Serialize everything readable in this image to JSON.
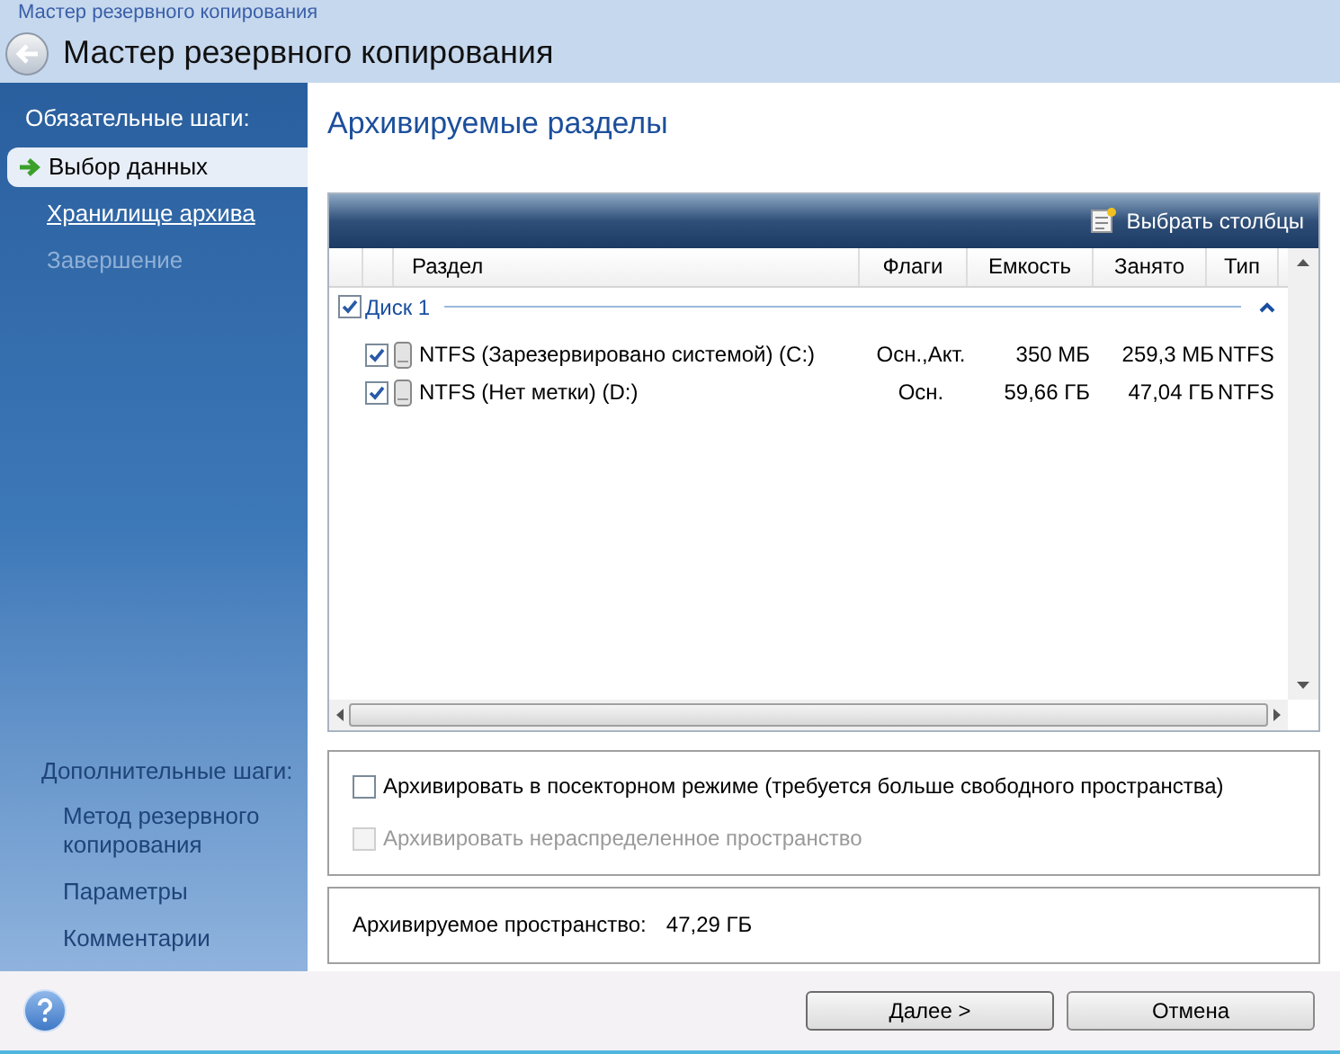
{
  "window": {
    "caption": "Мастер резервного копирования",
    "title": "Мастер резервного копирования"
  },
  "sidebar": {
    "required_heading": "Обязательные шаги:",
    "required_steps": [
      {
        "label": "Выбор данных",
        "kind": "current",
        "selected": true
      },
      {
        "label": "Хранилище архива",
        "kind": "link",
        "selected": false
      },
      {
        "label": "Завершение",
        "kind": "disabled",
        "selected": false
      }
    ],
    "optional_heading": "Дополнительные шаги:",
    "optional_steps": [
      {
        "label": "Метод резервного копирования"
      },
      {
        "label": "Параметры"
      },
      {
        "label": "Комментарии"
      }
    ]
  },
  "content": {
    "title": "Архивируемые разделы",
    "toolbar_button": "Выбрать столбцы",
    "table": {
      "columns": [
        "Раздел",
        "Флаги",
        "Емкость",
        "Занято",
        "Тип"
      ],
      "group": {
        "label": "Диск 1",
        "checked": true,
        "expanded": true
      },
      "rows": [
        {
          "checked": true,
          "name": "NTFS (Зарезервировано системой) (C:)",
          "flags": "Осн.,Акт.",
          "capacity": "350 МБ",
          "used": "259,3 МБ",
          "type": "NTFS"
        },
        {
          "checked": true,
          "name": "NTFS (Нет метки) (D:)",
          "flags": "Осн.",
          "capacity": "59,66 ГБ",
          "used": "47,04 ГБ",
          "type": "NTFS"
        }
      ]
    },
    "options": [
      {
        "label": "Архивировать в посекторном режиме (требуется больше свободного пространства)",
        "checked": false,
        "disabled": false
      },
      {
        "label": "Архивировать нераспределенное пространство",
        "checked": false,
        "disabled": true
      }
    ],
    "summary": {
      "label": "Архивируемое пространство:",
      "value": "47,29 ГБ"
    }
  },
  "buttons": [
    {
      "label": "Далее >",
      "kind": "primary"
    },
    {
      "label": "Отмена",
      "kind": "cancel"
    }
  ]
}
